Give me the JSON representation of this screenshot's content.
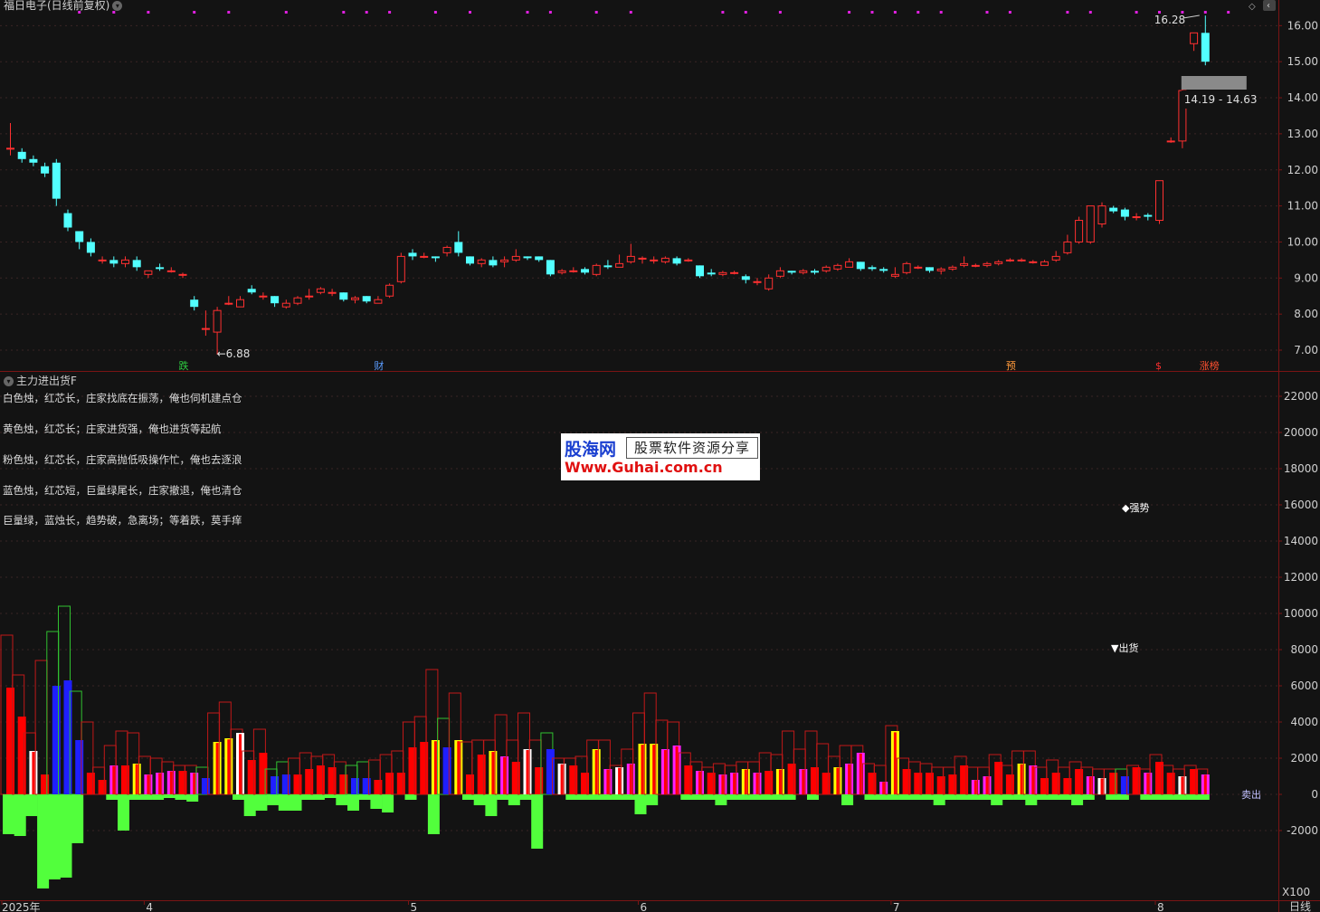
{
  "header": {
    "title": "福日电子(日线前复权)"
  },
  "indicator": {
    "name": "主力进出货F",
    "notes": [
      "白色烛，红芯长，庄家找底在振荡，俺也伺机建点仓",
      "黄色烛，红芯长；庄家进货强，俺也进货等起航",
      "粉色烛，红芯长，庄家高抛低吸操作忙，俺也去逐浪",
      "蓝色烛，红芯短，巨量绿尾长，庄家撤退，俺也清仓",
      "巨量绿，蓝烛长，趋势破，急离场；等着跌，莫手痒"
    ],
    "label_strong": "◆强势",
    "label_sell": "▼出货",
    "label_exit": "卖出"
  },
  "watermark": {
    "line1": "股海网",
    "line2": "股票软件资源分享",
    "line3": "Www.Guhai.com.cn"
  },
  "price_axis": {
    "ticks": [
      "16.00",
      "15.00",
      "14.00",
      "13.00",
      "12.00",
      "11.00",
      "10.00",
      "9.00",
      "8.00",
      "7.00"
    ]
  },
  "volume_axis": {
    "ticks": [
      "22000",
      "20000",
      "18000",
      "16000",
      "14000",
      "12000",
      "10000",
      "8000",
      "6000",
      "4000",
      "2000",
      "0",
      "-2000"
    ],
    "unit": "X100"
  },
  "time_axis": {
    "labels": [
      "2025年",
      "4",
      "5",
      "6",
      "7",
      "8"
    ],
    "period": "日线"
  },
  "price_labels": {
    "high": "16.28",
    "low": "←6.88",
    "range_box": "14.19 - 14.63"
  },
  "event_markers": [
    {
      "text": "跌",
      "color": "#2ecc40"
    },
    {
      "text": "财",
      "color": "#5a9cff"
    },
    {
      "text": "预",
      "color": "#ff9a3c"
    },
    {
      "text": "$",
      "color": "#ff3030"
    },
    {
      "text": "涨榜",
      "color": "#ff5030"
    }
  ],
  "colors": {
    "up": "#ff3030",
    "down": "#52ffff",
    "bar_green": "#52ff3c",
    "bar_blue": "#1f1fff",
    "bar_pink": "#ff1fff",
    "bar_yellow": "#ffff00",
    "bar_white": "#ffffff",
    "bar_red": "#ff0000"
  },
  "chart_data": {
    "type": "candlestick",
    "candles": [
      [
        12.6,
        12.6,
        13.3,
        12.4
      ],
      [
        12.5,
        12.3,
        12.6,
        12.2
      ],
      [
        12.3,
        12.2,
        12.4,
        12.1
      ],
      [
        12.1,
        11.9,
        12.2,
        11.8
      ],
      [
        12.2,
        11.2,
        12.3,
        11.0
      ],
      [
        10.8,
        10.4,
        10.9,
        10.3
      ],
      [
        10.3,
        10.0,
        10.3,
        9.8
      ],
      [
        10.0,
        9.7,
        10.1,
        9.6
      ],
      [
        9.5,
        9.5,
        9.6,
        9.4
      ],
      [
        9.5,
        9.4,
        9.6,
        9.3
      ],
      [
        9.4,
        9.5,
        9.6,
        9.3
      ],
      [
        9.5,
        9.3,
        9.6,
        9.2
      ],
      [
        9.1,
        9.2,
        9.2,
        9.0
      ],
      [
        9.3,
        9.25,
        9.4,
        9.2
      ],
      [
        9.2,
        9.2,
        9.3,
        9.15
      ],
      [
        9.1,
        9.1,
        9.15,
        9.0
      ],
      [
        8.4,
        8.2,
        8.5,
        8.1
      ],
      [
        7.6,
        7.6,
        8.1,
        7.4
      ],
      [
        7.5,
        8.1,
        8.2,
        6.88
      ],
      [
        8.3,
        8.3,
        8.5,
        8.25
      ],
      [
        8.2,
        8.4,
        8.5,
        8.2
      ],
      [
        8.7,
        8.6,
        8.8,
        8.55
      ],
      [
        8.5,
        8.5,
        8.6,
        8.4
      ],
      [
        8.5,
        8.3,
        8.5,
        8.2
      ],
      [
        8.2,
        8.3,
        8.4,
        8.15
      ],
      [
        8.3,
        8.45,
        8.5,
        8.25
      ],
      [
        8.5,
        8.5,
        8.7,
        8.4
      ],
      [
        8.6,
        8.7,
        8.75,
        8.55
      ],
      [
        8.6,
        8.6,
        8.7,
        8.5
      ],
      [
        8.6,
        8.4,
        8.6,
        8.35
      ],
      [
        8.4,
        8.45,
        8.5,
        8.3
      ],
      [
        8.5,
        8.35,
        8.5,
        8.3
      ],
      [
        8.3,
        8.4,
        8.5,
        8.3
      ],
      [
        8.5,
        8.8,
        8.85,
        8.45
      ],
      [
        8.9,
        9.6,
        9.7,
        8.85
      ],
      [
        9.7,
        9.6,
        9.8,
        9.5
      ],
      [
        9.6,
        9.6,
        9.7,
        9.55
      ],
      [
        9.6,
        9.55,
        9.6,
        9.45
      ],
      [
        9.7,
        9.85,
        9.9,
        9.6
      ],
      [
        10.0,
        9.7,
        10.3,
        9.6
      ],
      [
        9.6,
        9.4,
        9.6,
        9.35
      ],
      [
        9.4,
        9.5,
        9.55,
        9.3
      ],
      [
        9.5,
        9.35,
        9.6,
        9.3
      ],
      [
        9.45,
        9.5,
        9.6,
        9.3
      ],
      [
        9.5,
        9.6,
        9.8,
        9.45
      ],
      [
        9.6,
        9.55,
        9.6,
        9.5
      ],
      [
        9.6,
        9.5,
        9.6,
        9.45
      ],
      [
        9.5,
        9.1,
        9.5,
        9.05
      ],
      [
        9.15,
        9.2,
        9.25,
        9.1
      ],
      [
        9.2,
        9.2,
        9.3,
        9.15
      ],
      [
        9.25,
        9.15,
        9.3,
        9.1
      ],
      [
        9.1,
        9.35,
        9.4,
        9.05
      ],
      [
        9.35,
        9.3,
        9.5,
        9.25
      ],
      [
        9.3,
        9.4,
        9.65,
        9.3
      ],
      [
        9.45,
        9.6,
        9.95,
        9.4
      ],
      [
        9.55,
        9.55,
        9.6,
        9.4
      ],
      [
        9.5,
        9.5,
        9.6,
        9.4
      ],
      [
        9.45,
        9.55,
        9.6,
        9.4
      ],
      [
        9.55,
        9.4,
        9.6,
        9.35
      ],
      [
        9.5,
        9.5,
        9.55,
        9.45
      ],
      [
        9.35,
        9.05,
        9.35,
        9.0
      ],
      [
        9.15,
        9.1,
        9.25,
        9.05
      ],
      [
        9.1,
        9.15,
        9.2,
        9.05
      ],
      [
        9.15,
        9.15,
        9.2,
        9.1
      ],
      [
        9.05,
        8.95,
        9.1,
        8.85
      ],
      [
        8.9,
        8.9,
        9.0,
        8.8
      ],
      [
        8.7,
        9.0,
        9.1,
        8.65
      ],
      [
        9.05,
        9.2,
        9.3,
        9.0
      ],
      [
        9.2,
        9.15,
        9.2,
        9.1
      ],
      [
        9.15,
        9.2,
        9.25,
        9.1
      ],
      [
        9.2,
        9.15,
        9.25,
        9.1
      ],
      [
        9.2,
        9.3,
        9.35,
        9.15
      ],
      [
        9.25,
        9.35,
        9.4,
        9.2
      ],
      [
        9.3,
        9.45,
        9.55,
        9.3
      ],
      [
        9.45,
        9.25,
        9.45,
        9.2
      ],
      [
        9.3,
        9.25,
        9.35,
        9.2
      ],
      [
        9.25,
        9.2,
        9.3,
        9.15
      ],
      [
        9.05,
        9.1,
        9.3,
        9.0
      ],
      [
        9.15,
        9.4,
        9.45,
        9.1
      ],
      [
        9.3,
        9.3,
        9.35,
        9.25
      ],
      [
        9.3,
        9.2,
        9.3,
        9.15
      ],
      [
        9.2,
        9.25,
        9.3,
        9.1
      ],
      [
        9.25,
        9.3,
        9.35,
        9.2
      ],
      [
        9.35,
        9.4,
        9.6,
        9.3
      ],
      [
        9.35,
        9.35,
        9.4,
        9.3
      ],
      [
        9.35,
        9.4,
        9.45,
        9.3
      ],
      [
        9.4,
        9.45,
        9.5,
        9.35
      ],
      [
        9.5,
        9.5,
        9.55,
        9.45
      ],
      [
        9.5,
        9.5,
        9.55,
        9.45
      ],
      [
        9.45,
        9.45,
        9.5,
        9.4
      ],
      [
        9.35,
        9.45,
        9.5,
        9.35
      ],
      [
        9.5,
        9.6,
        9.75,
        9.45
      ],
      [
        9.7,
        10.0,
        10.2,
        9.65
      ],
      [
        10.0,
        10.6,
        10.7,
        9.95
      ],
      [
        10.0,
        11.0,
        11.0,
        9.95
      ],
      [
        10.5,
        11.0,
        11.1,
        10.4
      ],
      [
        10.95,
        10.85,
        11.0,
        10.8
      ],
      [
        10.9,
        10.7,
        10.95,
        10.6
      ],
      [
        10.7,
        10.7,
        10.8,
        10.6
      ],
      [
        10.75,
        10.7,
        10.8,
        10.6
      ],
      [
        10.6,
        11.7,
        11.7,
        10.5
      ],
      [
        12.8,
        12.8,
        12.9,
        12.75
      ],
      [
        12.8,
        14.2,
        14.3,
        12.6
      ],
      [
        15.5,
        15.8,
        15.8,
        15.3
      ],
      [
        15.8,
        15.0,
        16.28,
        14.9
      ]
    ],
    "volume": [
      [
        5,
        5.9,
        8.8,
        -2.2
      ],
      [
        5,
        4.3,
        6.6,
        -2.3
      ],
      [
        1,
        2.4,
        3.4,
        -1.2
      ],
      [
        5,
        1.1,
        7.4,
        -5.2
      ],
      [
        3,
        6.0,
        9.0,
        -4.7
      ],
      [
        3,
        6.3,
        10.4,
        -4.6
      ],
      [
        3,
        3.0,
        5.7,
        -2.7
      ],
      [
        5,
        1.2,
        4.0,
        0
      ],
      [
        5,
        0.8,
        1.5,
        0
      ],
      [
        4,
        1.6,
        2.7,
        -0.3
      ],
      [
        5,
        1.6,
        3.5,
        -2.0
      ],
      [
        2,
        1.7,
        3.4,
        -0.3
      ],
      [
        4,
        1.1,
        2.1,
        -0.3
      ],
      [
        4,
        1.2,
        2.0,
        -0.3
      ],
      [
        4,
        1.3,
        1.8,
        -0.2
      ],
      [
        6,
        1.3,
        1.6,
        -0.3
      ],
      [
        4,
        1.2,
        1.6,
        -0.4
      ],
      [
        3,
        0.9,
        1.5,
        0
      ],
      [
        2,
        2.9,
        4.5,
        0
      ],
      [
        2,
        3.1,
        5.1,
        0
      ],
      [
        1,
        3.4,
        3.6,
        -0.3
      ],
      [
        5,
        1.9,
        2.4,
        -1.2
      ],
      [
        5,
        2.3,
        3.6,
        -0.9
      ],
      [
        3,
        1.0,
        1.4,
        -0.6
      ],
      [
        3,
        1.1,
        1.8,
        -0.9
      ],
      [
        5,
        1.1,
        2.0,
        -0.9
      ],
      [
        5,
        1.4,
        2.3,
        -0.3
      ],
      [
        5,
        1.6,
        2.1,
        -0.3
      ],
      [
        6,
        1.5,
        2.2,
        -0.2
      ],
      [
        6,
        1.1,
        1.8,
        -0.6
      ],
      [
        3,
        0.9,
        1.6,
        -0.9
      ],
      [
        3,
        0.9,
        1.8,
        -0.3
      ],
      [
        6,
        0.8,
        1.9,
        -0.8
      ],
      [
        5,
        1.2,
        2.2,
        -1.0
      ],
      [
        5,
        1.2,
        2.4,
        0
      ],
      [
        5,
        2.6,
        4.0,
        -0.3
      ],
      [
        5,
        2.9,
        4.3,
        0
      ],
      [
        2,
        3.0,
        6.9,
        -2.2
      ],
      [
        3,
        2.6,
        4.2,
        0
      ],
      [
        2,
        3.0,
        5.6,
        0
      ],
      [
        6,
        1.1,
        2.9,
        -0.3
      ],
      [
        6,
        2.2,
        3.0,
        -0.6
      ],
      [
        2,
        2.4,
        3.0,
        -1.2
      ],
      [
        4,
        2.1,
        4.4,
        -0.3
      ],
      [
        5,
        1.8,
        3.0,
        -0.6
      ],
      [
        1,
        2.5,
        4.5,
        -0.3
      ],
      [
        5,
        1.5,
        3.0,
        -3.0
      ],
      [
        3,
        2.5,
        3.4,
        0
      ],
      [
        1,
        1.7,
        2.0,
        0
      ],
      [
        6,
        1.6,
        2.0,
        -0.3
      ],
      [
        6,
        1.2,
        2.1,
        -0.3
      ],
      [
        2,
        2.5,
        3.0,
        -0.3
      ],
      [
        4,
        1.4,
        3.0,
        -0.3
      ],
      [
        1,
        1.5,
        1.6,
        -0.3
      ],
      [
        4,
        1.7,
        2.5,
        -0.3
      ],
      [
        2,
        2.8,
        4.5,
        -1.1
      ],
      [
        2,
        2.8,
        5.6,
        -0.6
      ],
      [
        4,
        2.5,
        4.1,
        0
      ],
      [
        4,
        2.7,
        4.0,
        0
      ],
      [
        5,
        1.6,
        2.3,
        -0.3
      ],
      [
        4,
        1.3,
        1.8,
        -0.3
      ],
      [
        5,
        1.2,
        1.5,
        -0.3
      ],
      [
        4,
        1.1,
        1.7,
        -0.6
      ],
      [
        4,
        1.2,
        1.6,
        -0.3
      ],
      [
        2,
        1.4,
        1.8,
        -0.3
      ],
      [
        4,
        1.2,
        1.8,
        -0.3
      ],
      [
        5,
        1.3,
        2.3,
        -0.3
      ],
      [
        2,
        1.4,
        2.2,
        -0.3
      ],
      [
        5,
        1.7,
        3.5,
        -0.3
      ],
      [
        4,
        1.4,
        2.5,
        0
      ],
      [
        6,
        1.5,
        3.5,
        -0.3
      ],
      [
        6,
        1.2,
        2.8,
        0
      ],
      [
        2,
        1.5,
        2.1,
        0
      ],
      [
        4,
        1.7,
        2.7,
        -0.6
      ],
      [
        4,
        2.3,
        2.7,
        0
      ],
      [
        5,
        1.2,
        1.7,
        -0.3
      ],
      [
        4,
        0.7,
        1.6,
        -0.3
      ],
      [
        2,
        3.5,
        3.8,
        -0.3
      ],
      [
        5,
        1.4,
        2.0,
        -0.3
      ],
      [
        5,
        1.2,
        1.8,
        -0.3
      ],
      [
        5,
        1.2,
        1.7,
        -0.3
      ],
      [
        5,
        1.0,
        1.5,
        -0.6
      ],
      [
        5,
        1.1,
        1.5,
        -0.3
      ],
      [
        5,
        1.6,
        2.1,
        -0.3
      ],
      [
        4,
        0.8,
        1.5,
        -0.3
      ],
      [
        4,
        1.0,
        1.5,
        -0.3
      ],
      [
        5,
        1.8,
        2.2,
        -0.6
      ],
      [
        6,
        1.1,
        1.6,
        -0.3
      ],
      [
        2,
        1.7,
        2.4,
        -0.3
      ],
      [
        4,
        1.6,
        2.4,
        -0.6
      ],
      [
        6,
        0.9,
        1.5,
        -0.3
      ],
      [
        6,
        1.2,
        1.9,
        -0.3
      ],
      [
        6,
        0.9,
        1.5,
        -0.3
      ],
      [
        5,
        1.4,
        1.8,
        -0.6
      ],
      [
        4,
        1.0,
        1.5,
        -0.3
      ],
      [
        1,
        0.9,
        1.4,
        0
      ],
      [
        5,
        1.2,
        1.4,
        -0.3
      ],
      [
        3,
        1.0,
        1.4,
        -0.3
      ],
      [
        5,
        1.5,
        1.6,
        0
      ],
      [
        4,
        1.2,
        1.4,
        -0.3
      ],
      [
        5,
        1.8,
        2.2,
        -0.3
      ],
      [
        5,
        1.2,
        1.6,
        -0.3
      ],
      [
        1,
        1.0,
        1.4,
        -0.3
      ],
      [
        5,
        1.4,
        1.6,
        -0.3
      ],
      [
        4,
        1.1,
        1.4,
        -0.3
      ]
    ]
  }
}
